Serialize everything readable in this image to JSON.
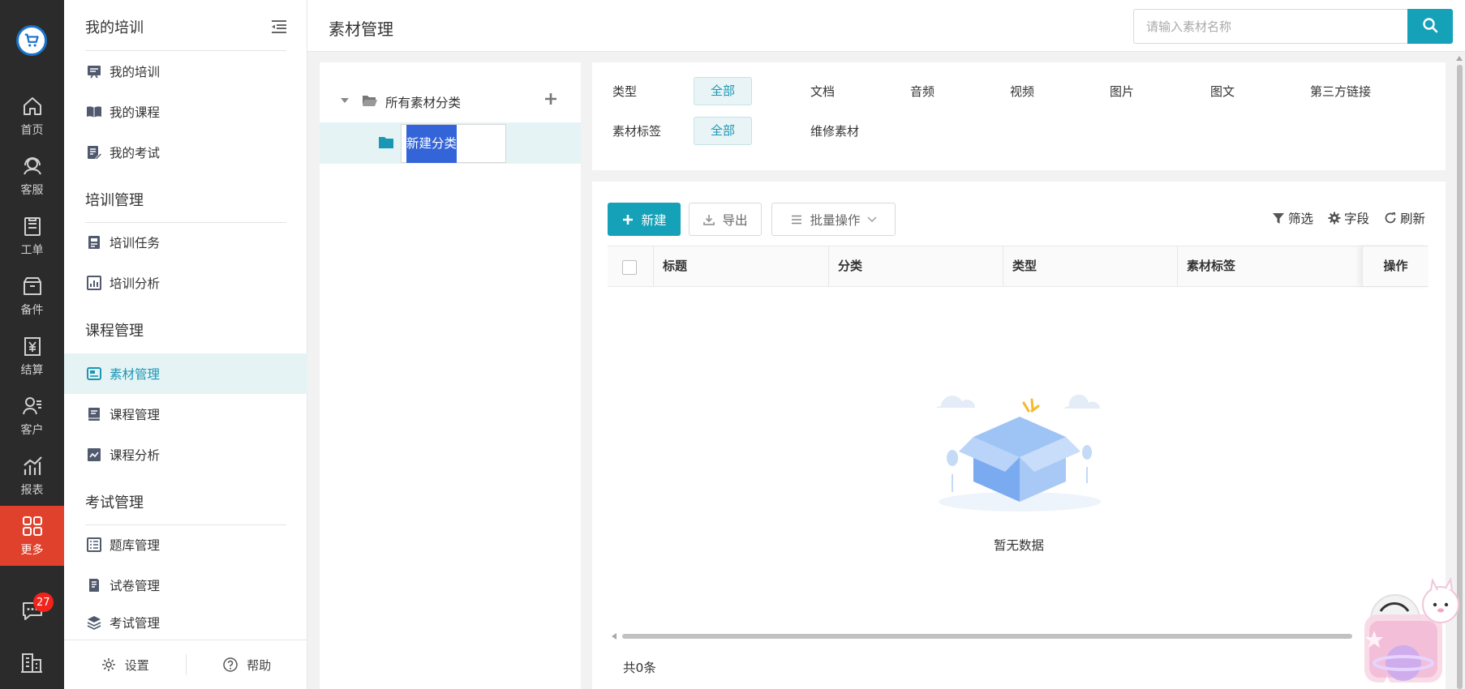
{
  "rail": {
    "items": [
      {
        "label": "首页",
        "icon": "home-icon"
      },
      {
        "label": "客服",
        "icon": "headset-icon"
      },
      {
        "label": "工单",
        "icon": "clipboard-icon"
      },
      {
        "label": "备件",
        "icon": "box-icon"
      },
      {
        "label": "结算",
        "icon": "yen-invoice-icon"
      },
      {
        "label": "客户",
        "icon": "customer-icon"
      },
      {
        "label": "报表",
        "icon": "chart-icon"
      },
      {
        "label": "更多",
        "icon": "grid-icon",
        "active": true
      }
    ],
    "message_badge": "27"
  },
  "sidebar": {
    "groups": [
      {
        "title": "我的培训",
        "items": [
          "我的培训",
          "我的课程",
          "我的考试"
        ]
      },
      {
        "title": "培训管理",
        "items": [
          "培训任务",
          "培训分析"
        ]
      },
      {
        "title": "课程管理",
        "items": [
          "素材管理",
          "课程管理",
          "课程分析"
        ]
      },
      {
        "title": "考试管理",
        "items": [
          "题库管理",
          "试卷管理",
          "考试管理"
        ]
      }
    ],
    "active_item": "素材管理",
    "footer": {
      "settings": "设置",
      "help": "帮助"
    }
  },
  "header": {
    "title": "素材管理",
    "search_placeholder": "请输入素材名称"
  },
  "tree": {
    "root_label": "所有素材分类",
    "child_editing_value": "新建分类"
  },
  "filters": {
    "type_label": "类型",
    "type_options": [
      "全部",
      "文档",
      "音频",
      "视频",
      "图片",
      "图文",
      "第三方链接"
    ],
    "tag_label": "素材标签",
    "tag_options": [
      "全部",
      "维修素材"
    ]
  },
  "toolbar": {
    "new": "新建",
    "export": "导出",
    "batch": "批量操作",
    "filter": "筛选",
    "fields": "字段",
    "refresh": "刷新"
  },
  "table": {
    "columns": [
      "标题",
      "分类",
      "类型",
      "素材标签"
    ],
    "action_column": "操作",
    "empty_text": "暂无数据",
    "total": "共0条"
  },
  "colors": {
    "accent": "#15a1b8",
    "rail_bg": "#2b2b2b",
    "rail_active": "#e0412d",
    "badge": "#f2231a",
    "selection": "#3465d8"
  }
}
